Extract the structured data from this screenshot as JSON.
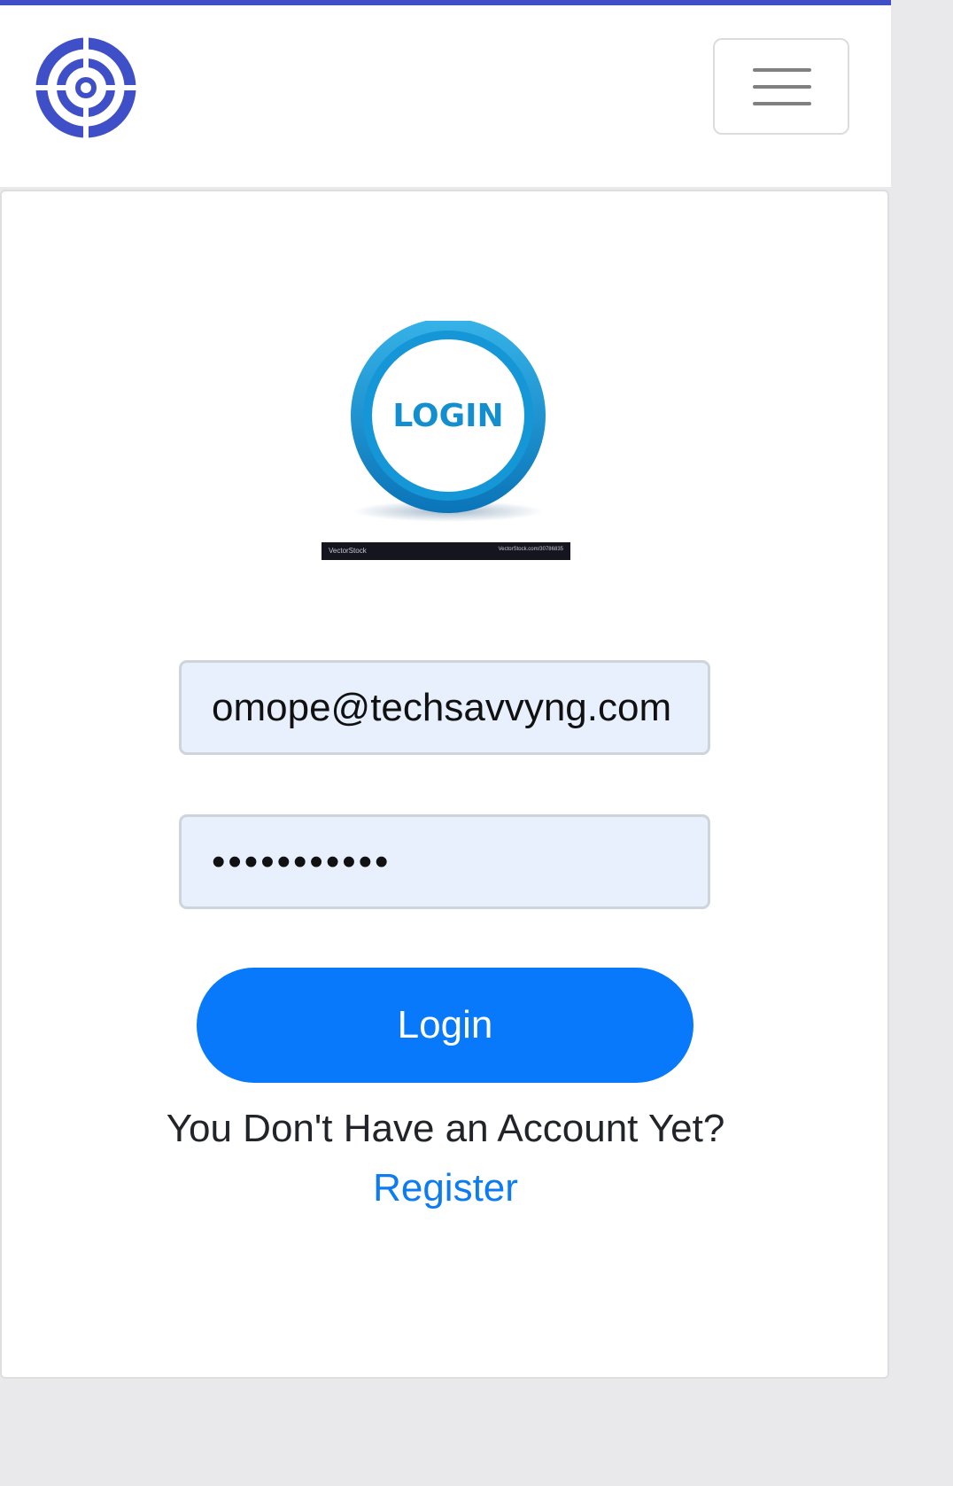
{
  "colors": {
    "accent": "#3f4fc8",
    "primary_button": "#0779fa",
    "link": "#0d7bf2",
    "input_background": "#e8f0fe"
  },
  "navbar": {
    "brand_icon": "target-crosshair-icon",
    "menu_icon": "hamburger-menu-icon"
  },
  "login_form": {
    "illustration": {
      "label": "LOGIN",
      "stock_credit": "VectorStock",
      "stock_id": "VectorStock.com/30786835"
    },
    "email_value": "omope@techsavvyng.com",
    "password_value": "jzpasswordx",
    "login_label": "Login",
    "account_prompt": "You Don't Have an Account Yet?",
    "register_label": "Register"
  }
}
